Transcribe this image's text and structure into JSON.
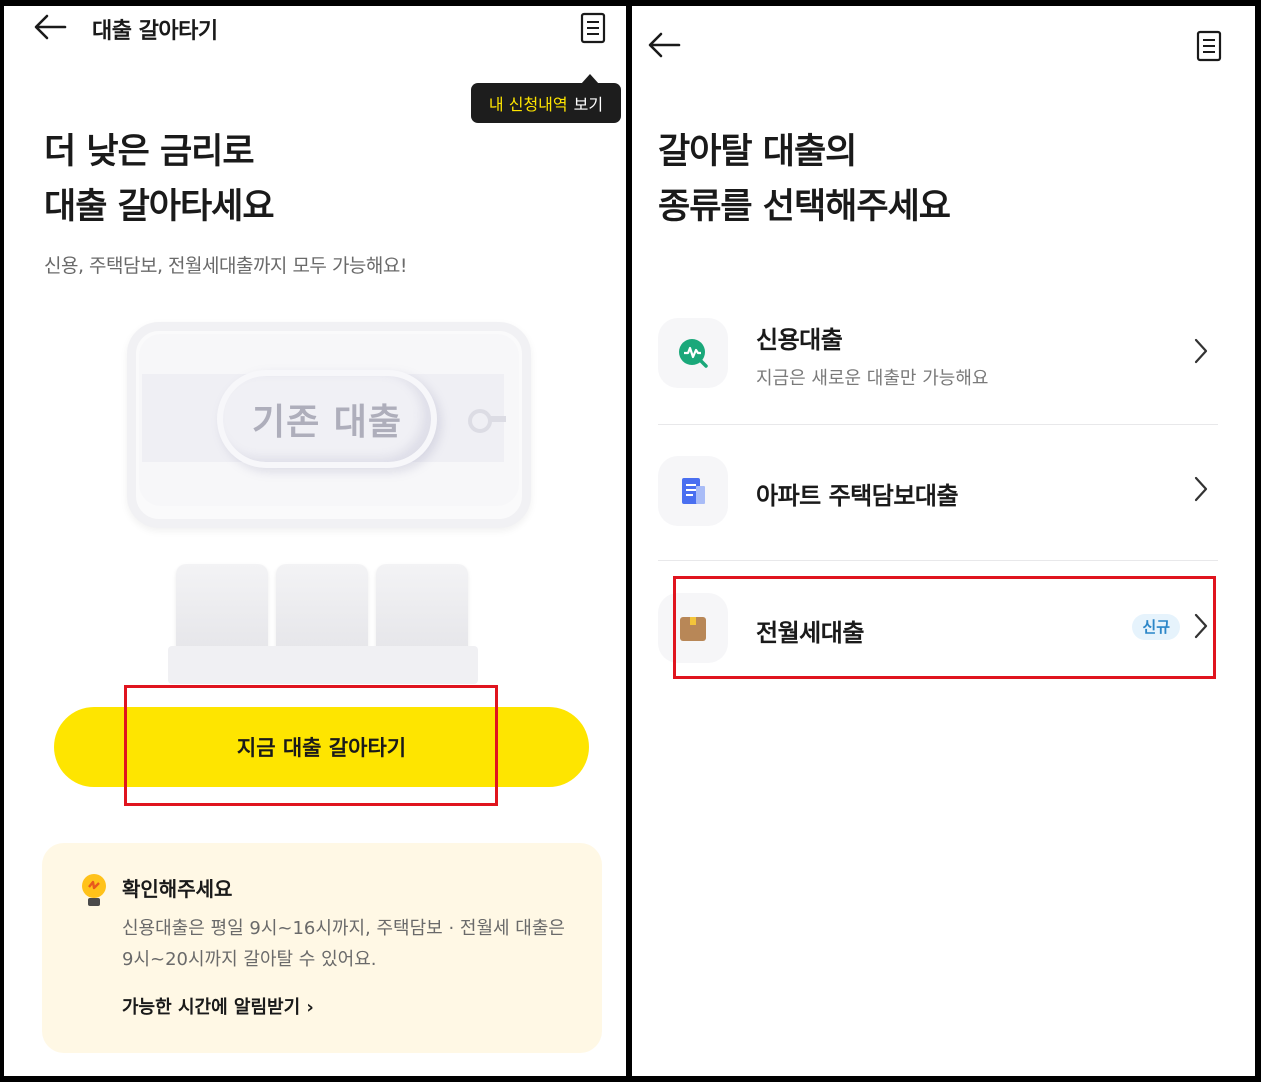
{
  "left": {
    "header": {
      "title": "대출 갈아타기"
    },
    "tooltip": {
      "highlight": "내 신청내역",
      "rest": "보기"
    },
    "headline": "더 낮은 금리로\n대출 갈아타세요",
    "subtitle": "신용, 주택담보, 전월세대출까지 모두 가능해요!",
    "illustration": {
      "pill_label": "기존 대출"
    },
    "cta_label": "지금 대출 갈아타기",
    "notice": {
      "title": "확인해주세요",
      "body": "신용대출은 평일 9시~16시까지, 주택담보 · 전월세 대출은 9시~20시까지 갈아탈 수 있어요.",
      "link": "가능한 시간에 알림받기 ›"
    }
  },
  "right": {
    "headline": "갈아탈 대출의\n종류를 선택해주세요",
    "items": [
      {
        "title": "신용대출",
        "desc": "지금은 새로운 대출만 가능해요",
        "icon": "credit-chart-icon"
      },
      {
        "title": "아파트 주택담보대출",
        "icon": "apartment-document-icon"
      },
      {
        "title": "전월세대출",
        "badge": "신규",
        "icon": "box-icon"
      }
    ]
  },
  "colors": {
    "accent_yellow": "#FEE500",
    "tooltip_dark": "#1D1D1D",
    "highlight_red": "#E0141E",
    "badge_blue": "#2B86C8",
    "notice_bg": "#FFF8E5"
  }
}
